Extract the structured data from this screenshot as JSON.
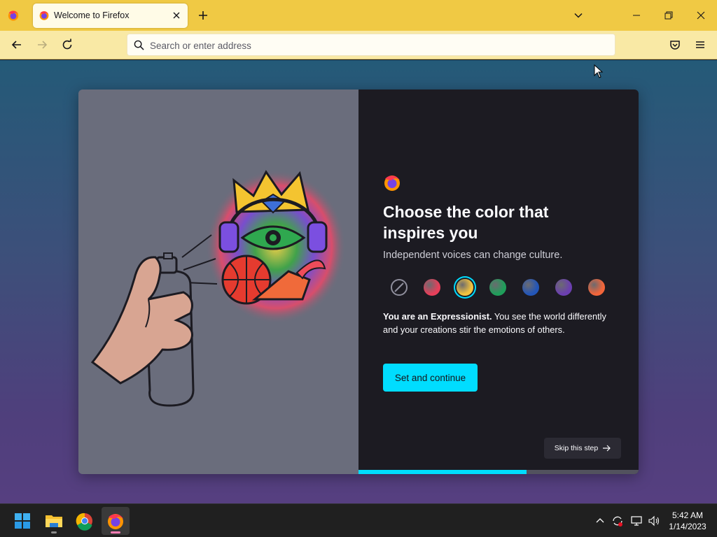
{
  "browser": {
    "tab": {
      "title": "Welcome to Firefox"
    },
    "urlbar": {
      "placeholder": "Search or enter address",
      "value": ""
    }
  },
  "onboarding": {
    "headline": "Choose the color that inspires you",
    "subheadline": "Independent voices can change culture.",
    "colorways": [
      {
        "name": "Default (none)",
        "color": "none",
        "selected": false
      },
      {
        "name": "Red",
        "color": "#e63f5a",
        "selected": false
      },
      {
        "name": "Yellow",
        "color": "#f2c23e",
        "selected": true
      },
      {
        "name": "Green",
        "color": "#1f9e5a",
        "selected": false
      },
      {
        "name": "Blue",
        "color": "#2356b8",
        "selected": false
      },
      {
        "name": "Purple",
        "color": "#6b3fb0",
        "selected": false
      },
      {
        "name": "Orange",
        "color": "#f2653a",
        "selected": false
      }
    ],
    "description_bold": "You are an Expressionist.",
    "description_text": " You see the world differently and your creations stir the emotions of others.",
    "primary_button": "Set and continue",
    "skip_button": "Skip this step",
    "progress": 0.6
  },
  "taskbar": {
    "apps": [
      "start-icon",
      "file-explorer-icon",
      "chrome-icon",
      "firefox-icon"
    ],
    "clock": {
      "time": "5:42 AM",
      "date": "1/14/2023"
    }
  },
  "colors": {
    "accent": "#00ddff",
    "tabstrip": "#f0c944",
    "navbar": "#f9e9a5"
  }
}
